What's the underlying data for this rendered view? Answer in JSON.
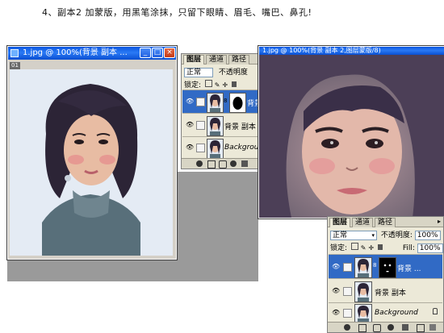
{
  "caption": "4、副本2 加蒙版，用黑笔涂抹，只留下眼睛、眉毛、嘴巴、鼻孔!",
  "doc_window": {
    "title": "1.jpg @ 100%(背景 副本 ...",
    "corner_tag": "01",
    "buttons": {
      "minimize": "_",
      "maximize": "□",
      "close": "×"
    }
  },
  "layers_panel_top": {
    "tabs": [
      "图层",
      "通道",
      "路径"
    ],
    "blend_mode": "正常",
    "opacity_label": "不透明度",
    "lock_label": "锁定:",
    "layers": [
      {
        "name": "背景",
        "has_mask": true
      },
      {
        "name": "背景 副本",
        "has_mask": false
      },
      {
        "name": "Background",
        "has_mask": false
      }
    ]
  },
  "layers_panel_bottom": {
    "tabs": [
      "图层",
      "通道",
      "路径"
    ],
    "blend_mode": "正常",
    "opacity_label": "不透明度:",
    "opacity_value": "100%",
    "lock_label": "锁定:",
    "fill_label": "Fill:",
    "fill_value": "100%",
    "layers": [
      {
        "name": "背景 ...",
        "has_mask": true
      },
      {
        "name": "背景 副本",
        "has_mask": false
      },
      {
        "name": "Background",
        "has_mask": false
      }
    ]
  },
  "preview_window": {
    "title": "1.jpg @ 100%(背景 副本 2,图层蒙版/8)"
  },
  "colors": {
    "titlebar": "#0a55e0",
    "workspace": "#9a9a9a",
    "panel": "#ece9d8",
    "selected_layer": "#316ac5"
  }
}
